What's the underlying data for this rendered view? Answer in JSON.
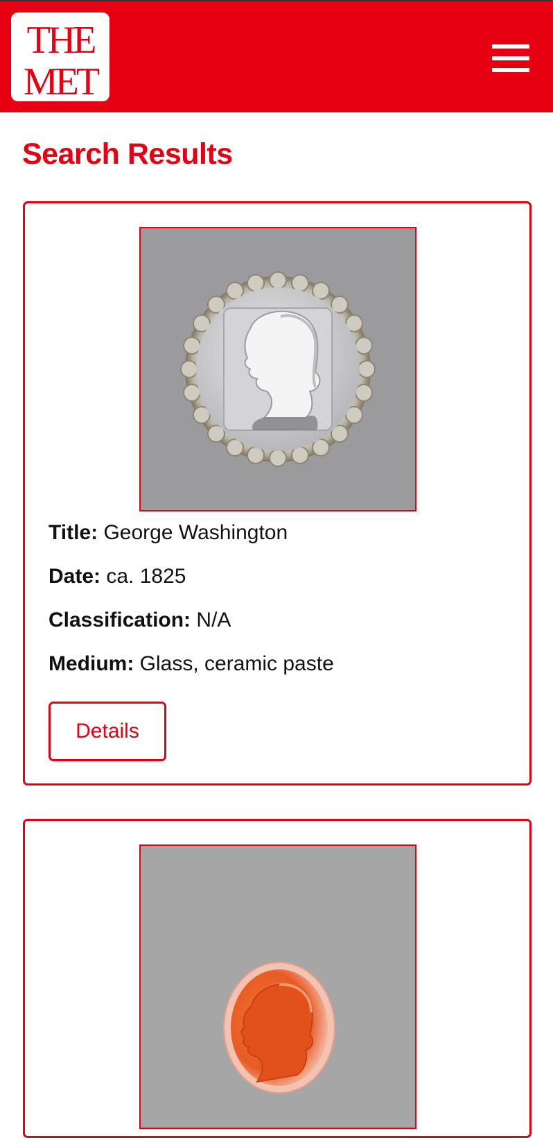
{
  "header": {
    "logo_text": [
      "THE",
      "MET"
    ],
    "menu_icon": "hamburger-menu-icon",
    "brand_color": "#e60012"
  },
  "page": {
    "title": "Search Results"
  },
  "results": [
    {
      "image_icon": "cameo-portrait-glass",
      "title_label": "Title:",
      "title_value": "George Washington",
      "date_label": "Date:",
      "date_value": "ca. 1825",
      "classification_label": "Classification:",
      "classification_value": "N/A",
      "medium_label": "Medium:",
      "medium_value": "Glass, ceramic paste",
      "details_label": "Details"
    },
    {
      "image_icon": "cameo-portrait-carnelian"
    }
  ]
}
